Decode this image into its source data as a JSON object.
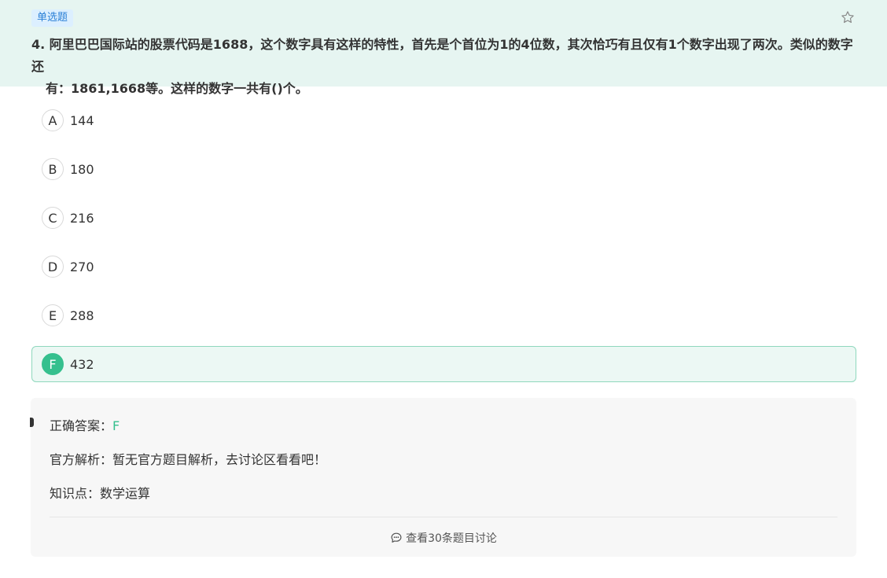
{
  "question": {
    "type_label": "单选题",
    "number": "4.",
    "text_line1": "阿里巴巴国际站的股票代码是1688，这个数字具有这样的特性，首先是个首位为1的4位数，其次恰巧有且仅有1个数字出现了两次。类似的数字还",
    "text_line2": "有：1861,1668等。这样的数字一共有()个。"
  },
  "options": [
    {
      "letter": "A",
      "text": "144"
    },
    {
      "letter": "B",
      "text": "180"
    },
    {
      "letter": "C",
      "text": "216"
    },
    {
      "letter": "D",
      "text": "270"
    },
    {
      "letter": "E",
      "text": "288"
    },
    {
      "letter": "F",
      "text": "432"
    }
  ],
  "selected_option": "F",
  "answer": {
    "correct_label": "正确答案：",
    "correct_value": "F",
    "analysis_label": "官方解析：",
    "analysis_text": "暂无官方题目解析，去讨论区看看吧！",
    "knowledge_label": "知识点：",
    "knowledge_text": "数学运算",
    "discuss_link": "查看30条题目讨论"
  },
  "icons": {
    "favorite": "star-icon",
    "discussion": "chat-icon"
  },
  "colors": {
    "accent": "#35c08e",
    "header_bg": "#e6f5f1",
    "badge_bg": "#dcefff",
    "badge_text": "#2a7fd6"
  }
}
